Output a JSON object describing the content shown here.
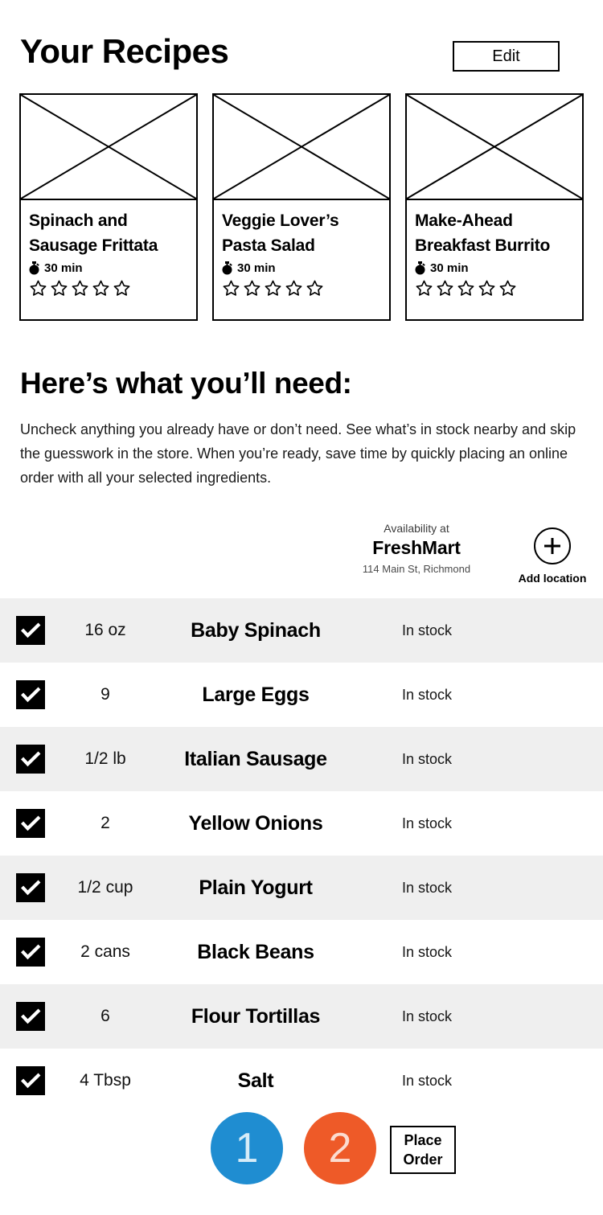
{
  "header": {
    "title": "Your Recipes",
    "edit_label": "Edit"
  },
  "recipes": [
    {
      "name": "Spinach and Sausage Frittata",
      "time": "30 min",
      "rating": 0,
      "max_rating": 5,
      "thumb": "image-placeholder"
    },
    {
      "name": "Veggie Lover’s Pasta Salad",
      "time": "30 min",
      "rating": 0,
      "max_rating": 5,
      "thumb": "image-placeholder"
    },
    {
      "name": "Make-Ahead Breakfast Burrito",
      "time": "30 min",
      "rating": 0,
      "max_rating": 5,
      "thumb": "image-placeholder"
    }
  ],
  "needs": {
    "title": "Here’s what you’ll need:",
    "description": "Uncheck anything you already have or don’t need.  See what’s in stock nearby and skip the guesswork in the store.  When you’re ready, save time by quickly placing an online order with all your selected ingredients."
  },
  "store": {
    "availability_label": "Availability at",
    "name": "FreshMart",
    "address": "114 Main St, Richmond",
    "add_location_label": "Add location",
    "add_location_icon": "plus-circle-icon"
  },
  "ingredients": [
    {
      "checked": true,
      "quantity": "16 oz",
      "name": "Baby Spinach",
      "stock": "In stock"
    },
    {
      "checked": true,
      "quantity": "9",
      "name": "Large Eggs",
      "stock": "In stock"
    },
    {
      "checked": true,
      "quantity": "1/2 lb",
      "name": "Italian Sausage",
      "stock": "In stock"
    },
    {
      "checked": true,
      "quantity": "2",
      "name": "Yellow Onions",
      "stock": "In stock"
    },
    {
      "checked": true,
      "quantity": "1/2 cup",
      "name": "Plain Yogurt",
      "stock": "In stock"
    },
    {
      "checked": true,
      "quantity": "2 cans",
      "name": "Black Beans",
      "stock": "In stock"
    },
    {
      "checked": true,
      "quantity": "6",
      "name": "Flour Tortillas",
      "stock": "In stock"
    },
    {
      "checked": true,
      "quantity": "4 Tbsp",
      "name": "Salt",
      "stock": "In stock"
    }
  ],
  "steps": [
    {
      "label": "1",
      "color": "#1f8dd1",
      "text_color": "#d6ecf8"
    },
    {
      "label": "2",
      "color": "#ee5a28",
      "text_color": "#fbdcd0"
    }
  ],
  "place_order": {
    "line1": "Place",
    "line2": "Order"
  },
  "colors": {
    "row_alt": "#efefef",
    "step_one": "#1f8dd1",
    "step_two": "#ee5a28",
    "ink": "#000000"
  }
}
